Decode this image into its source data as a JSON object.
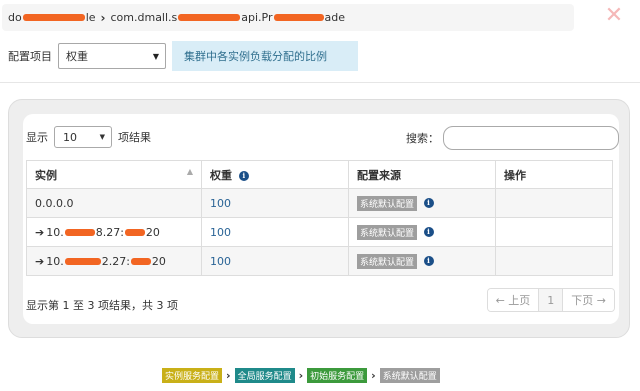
{
  "breadcrumb": {
    "items": [
      {
        "prefix": "do",
        "suffix": "le"
      },
      {
        "prefix": "com.dmall.s",
        "middle": "api.Pr",
        "suffix": "ade"
      }
    ]
  },
  "config": {
    "label": "配置项目",
    "select_value": "权重",
    "hint": "集群中各实例负载分配的比例"
  },
  "table_controls": {
    "show_label": "显示",
    "page_length": "10",
    "items_label": "项结果",
    "search_label": "搜索：",
    "search_value": ""
  },
  "table": {
    "headers": [
      "实例",
      "权重",
      "配置来源",
      "操作"
    ],
    "rows": [
      {
        "instance_prefix": "",
        "instance_mid": "",
        "instance_suffix": "0.0.0.0",
        "has_arrow": false,
        "weight": "100",
        "source": "系统默认配置"
      },
      {
        "instance_prefix": "10.",
        "instance_mid": "8.27:",
        "instance_suffix": "20",
        "has_arrow": true,
        "weight": "100",
        "source": "系统默认配置"
      },
      {
        "instance_prefix": "10.",
        "instance_mid": "2.27:",
        "instance_suffix": "20",
        "has_arrow": true,
        "weight": "100",
        "source": "系统默认配置"
      }
    ]
  },
  "table_info": "显示第 1 至 3 项结果，共 3 项",
  "pager": {
    "prev": "← 上页",
    "current": "1",
    "next": "下页 →"
  },
  "footer_flow": [
    {
      "label": "实例服务配置",
      "color": "#c9b018"
    },
    {
      "label": "全局服务配置",
      "color": "#1f8a8a"
    },
    {
      "label": "初始服务配置",
      "color": "#3c9a3c"
    },
    {
      "label": "系统默认配置",
      "color": "#9e9e9e"
    }
  ],
  "icons": {
    "close": "close-icon",
    "info": "info-icon",
    "sort": "sort-asc-icon",
    "arrow": "arrow-right-icon"
  }
}
